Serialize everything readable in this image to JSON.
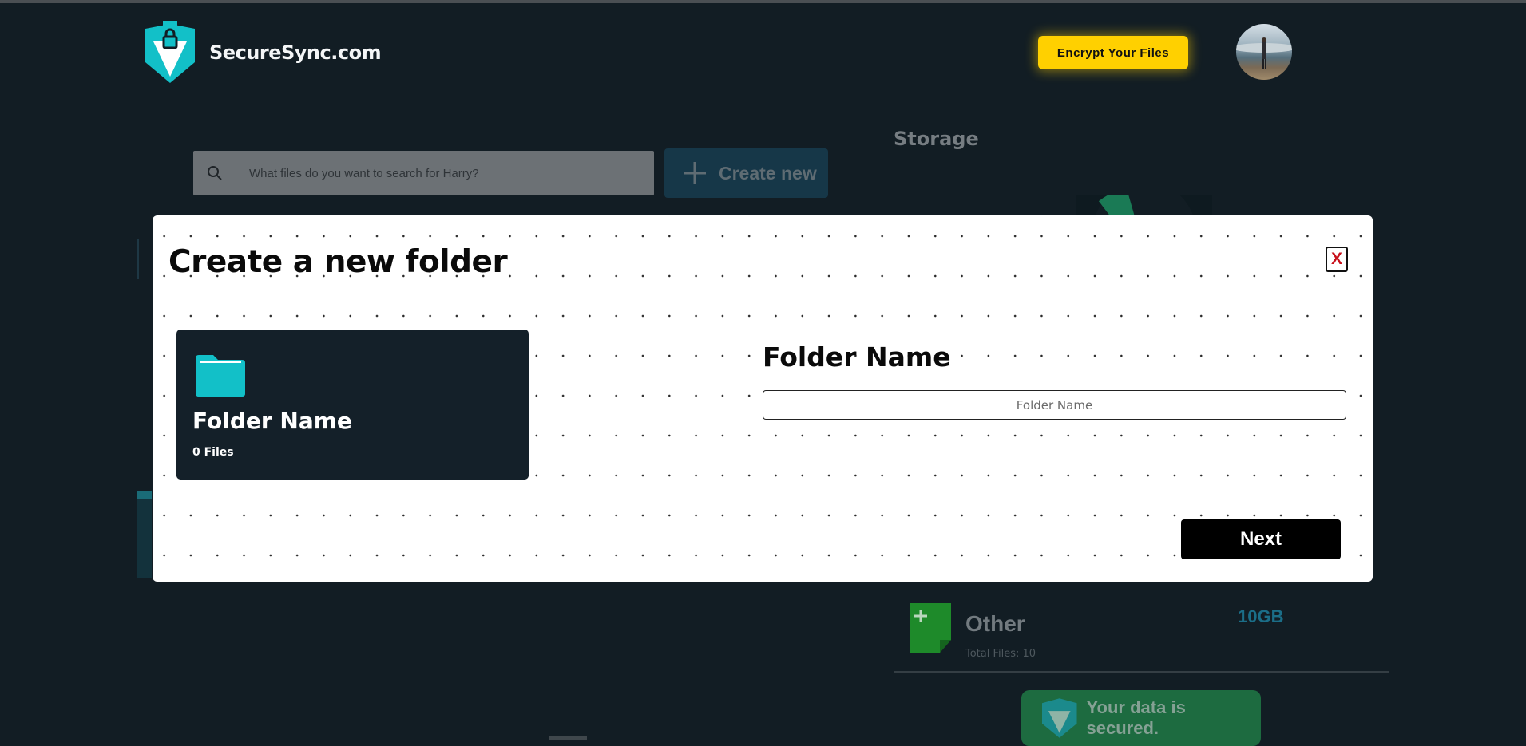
{
  "header": {
    "brand": "SecureSync.com",
    "logo_icon": "shield-lock-icon",
    "encrypt_label": "Encrypt Your Files",
    "avatar_icon": "user-avatar"
  },
  "search": {
    "placeholder": "What files do you want to search for Harry?",
    "icon": "search-icon"
  },
  "create_new": {
    "label": "Create new",
    "icon": "plus-icon"
  },
  "storage": {
    "title": "Storage",
    "other": {
      "title": "Other",
      "files": "Total Files: 10",
      "size": "10GB",
      "icon": "file-plus-icon"
    }
  },
  "secured_badge": {
    "label": "Your data is secured.",
    "icon": "shield-icon"
  },
  "modal": {
    "title": "Create a new folder",
    "close_label": "X",
    "preview": {
      "name": "Folder Name",
      "files": "0 Files",
      "icon": "folder-icon"
    },
    "field_label": "Folder Name",
    "input_placeholder": "Folder Name",
    "input_value": "",
    "next_label": "Next"
  },
  "colors": {
    "background": "#121d24",
    "accent_teal": "#12c0c8",
    "button_yellow": "#ffd000",
    "card_dark": "#142029",
    "close_red": "#c8101a"
  }
}
